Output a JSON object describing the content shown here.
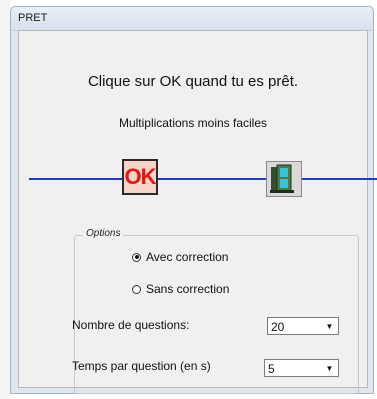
{
  "window": {
    "title": "PRET"
  },
  "dialog": {
    "message": "Clique sur OK quand tu es prêt.",
    "subtitle": "Multiplications moins faciles",
    "ok_label": "OK"
  },
  "options": {
    "legend": "Options",
    "radios": [
      {
        "label": "Avec correction",
        "selected": true
      },
      {
        "label": "Sans correction",
        "selected": false
      }
    ],
    "questions": {
      "label": "Nombre de questions:",
      "value": "20"
    },
    "time": {
      "label": "Temps par question (en s)",
      "value": "5"
    }
  }
}
